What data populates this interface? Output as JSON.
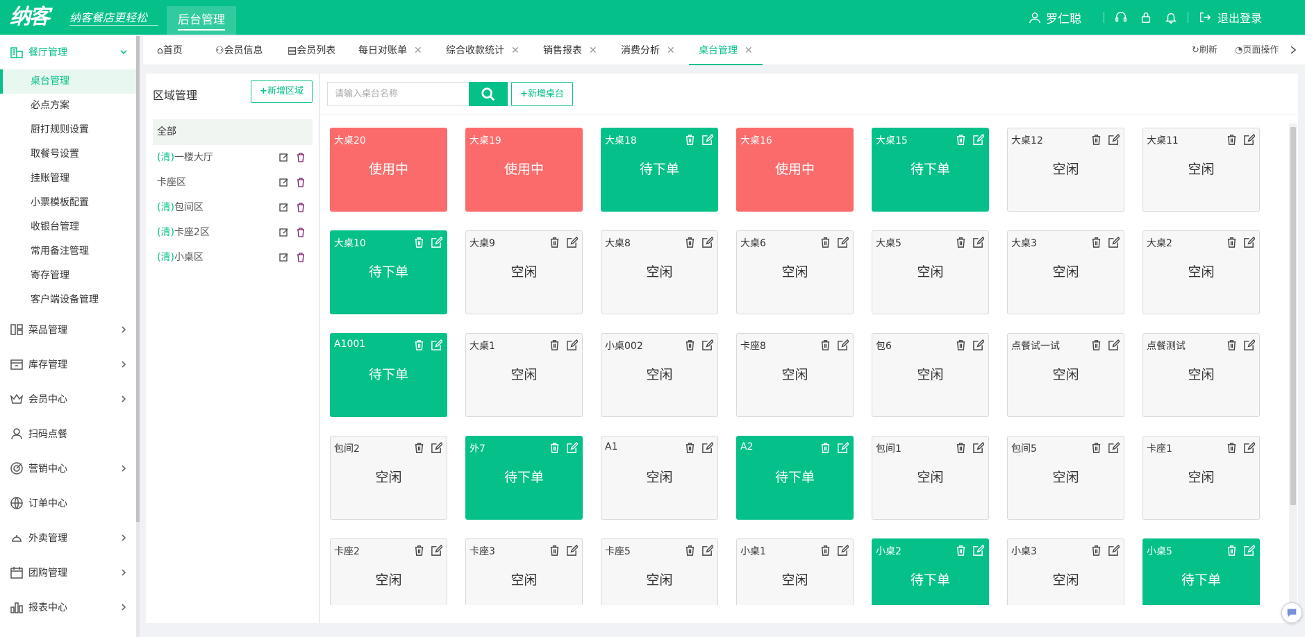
{
  "header": {
    "logo": "纳客",
    "slogan": "纳客餐店更轻松",
    "admin_tab": "后台管理",
    "user_name": "罗仁聪",
    "logout": "退出登录"
  },
  "sidebar": {
    "groups": [
      {
        "label": "餐厅管理",
        "icon": "store-icon",
        "expanded": true
      },
      {
        "label": "菜品管理",
        "icon": "dishes-icon"
      },
      {
        "label": "库存管理",
        "icon": "inventory-icon"
      },
      {
        "label": "会员中心",
        "icon": "crown-icon"
      },
      {
        "label": "扫码点餐",
        "icon": "user-icon"
      },
      {
        "label": "营销中心",
        "icon": "target-icon"
      },
      {
        "label": "订单中心",
        "icon": "globe-icon"
      },
      {
        "label": "外卖管理",
        "icon": "delivery-icon"
      },
      {
        "label": "团购管理",
        "icon": "calendar-icon"
      },
      {
        "label": "报表中心",
        "icon": "chart-icon"
      }
    ],
    "sub_items": [
      {
        "label": "桌台管理",
        "selected": true
      },
      {
        "label": "必点方案"
      },
      {
        "label": "厨打规则设置"
      },
      {
        "label": "取餐号设置"
      },
      {
        "label": "挂账管理"
      },
      {
        "label": "小票模板配置"
      },
      {
        "label": "收银台管理"
      },
      {
        "label": "常用备注管理"
      },
      {
        "label": "寄存管理"
      },
      {
        "label": "客户端设备管理"
      }
    ]
  },
  "tabs": [
    {
      "label": "首页",
      "icon": "home-icon",
      "closable": false
    },
    {
      "label": "会员信息",
      "icon": "user-icon",
      "closable": false
    },
    {
      "label": "会员列表",
      "icon": "clipboard-icon",
      "closable": false
    },
    {
      "label": "每日对账单",
      "closable": true
    },
    {
      "label": "综合收款统计",
      "closable": true
    },
    {
      "label": "销售报表",
      "closable": true
    },
    {
      "label": "消费分析",
      "closable": true
    },
    {
      "label": "桌台管理",
      "closable": true,
      "active": true
    }
  ],
  "tab_tools": {
    "refresh": "刷新",
    "page_ops": "页面操作",
    "close_mark": "✕"
  },
  "area_panel": {
    "title": "区域管理",
    "add_button": "新增区域",
    "all_label": "全部",
    "areas": [
      {
        "prefix": "(清)",
        "name": "一楼大厅"
      },
      {
        "prefix": "",
        "name": "卡座区"
      },
      {
        "prefix": "(清)",
        "name": "包间区"
      },
      {
        "prefix": "(清)",
        "name": "卡座2区"
      },
      {
        "prefix": "(清)",
        "name": "小桌区"
      }
    ]
  },
  "main": {
    "search_placeholder": "请输入桌台名称",
    "add_table_button": "新增桌台"
  },
  "colors": {
    "brand": "#06c08a",
    "busy": "#fb6b6b",
    "idle_bg": "#f7f7f7"
  },
  "tables": [
    {
      "name": "大桌20",
      "status": "使用中",
      "state": "busy"
    },
    {
      "name": "大桌19",
      "status": "使用中",
      "state": "busy"
    },
    {
      "name": "大桌18",
      "status": "待下单",
      "state": "wait"
    },
    {
      "name": "大桌16",
      "status": "使用中",
      "state": "busy"
    },
    {
      "name": "大桌15",
      "status": "待下单",
      "state": "wait"
    },
    {
      "name": "大桌12",
      "status": "空闲",
      "state": "idle"
    },
    {
      "name": "大桌11",
      "status": "空闲",
      "state": "idle"
    },
    {
      "name": "大桌10",
      "status": "待下单",
      "state": "wait"
    },
    {
      "name": "大桌9",
      "status": "空闲",
      "state": "idle"
    },
    {
      "name": "大桌8",
      "status": "空闲",
      "state": "idle"
    },
    {
      "name": "大桌6",
      "status": "空闲",
      "state": "idle"
    },
    {
      "name": "大桌5",
      "status": "空闲",
      "state": "idle"
    },
    {
      "name": "大桌3",
      "status": "空闲",
      "state": "idle"
    },
    {
      "name": "大桌2",
      "status": "空闲",
      "state": "idle"
    },
    {
      "name": "A1001",
      "status": "待下单",
      "state": "wait"
    },
    {
      "name": "大桌1",
      "status": "空闲",
      "state": "idle"
    },
    {
      "name": "小桌002",
      "status": "空闲",
      "state": "idle"
    },
    {
      "name": "卡座8",
      "status": "空闲",
      "state": "idle"
    },
    {
      "name": "包6",
      "status": "空闲",
      "state": "idle"
    },
    {
      "name": "点餐试一试",
      "status": "空闲",
      "state": "idle"
    },
    {
      "name": "点餐测试",
      "status": "空闲",
      "state": "idle"
    },
    {
      "name": "包间2",
      "status": "空闲",
      "state": "idle"
    },
    {
      "name": "外7",
      "status": "待下单",
      "state": "wait"
    },
    {
      "name": "A1",
      "status": "空闲",
      "state": "idle"
    },
    {
      "name": "A2",
      "status": "待下单",
      "state": "wait"
    },
    {
      "name": "包间1",
      "status": "空闲",
      "state": "idle"
    },
    {
      "name": "包间5",
      "status": "空闲",
      "state": "idle"
    },
    {
      "name": "卡座1",
      "status": "空闲",
      "state": "idle"
    },
    {
      "name": "卡座2",
      "status": "空闲",
      "state": "idle"
    },
    {
      "name": "卡座3",
      "status": "空闲",
      "state": "idle"
    },
    {
      "name": "卡座5",
      "status": "空闲",
      "state": "idle"
    },
    {
      "name": "小桌1",
      "status": "空闲",
      "state": "idle"
    },
    {
      "name": "小桌2",
      "status": "待下单",
      "state": "wait"
    },
    {
      "name": "小桌3",
      "status": "空闲",
      "state": "idle"
    },
    {
      "name": "小桌5",
      "status": "待下单",
      "state": "wait"
    }
  ]
}
